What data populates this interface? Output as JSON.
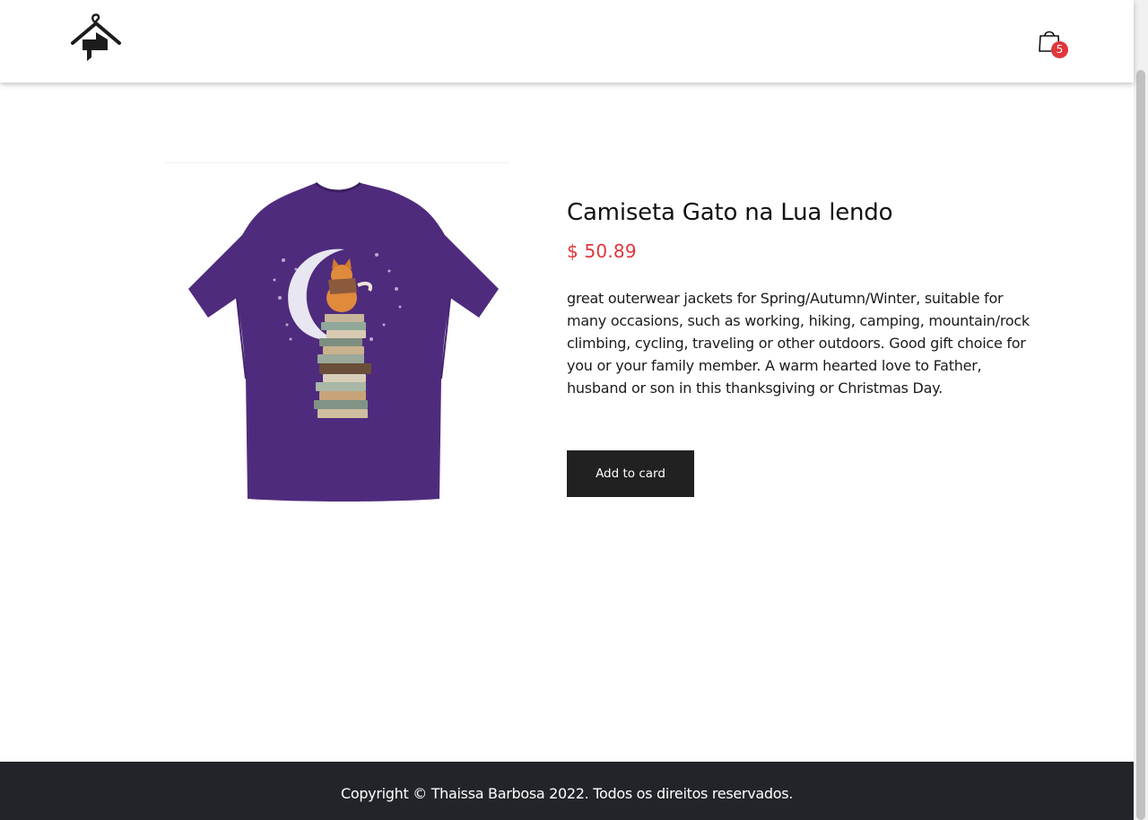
{
  "header": {
    "logo_icon": "hanger-house-logo-icon",
    "cart_icon": "shopping-bag-icon",
    "cart_count": "5",
    "cart_badge_color": "#e0353b"
  },
  "product": {
    "image_icon": "purple-tshirt-cat-moon-books-image",
    "title": "Camiseta Gato na Lua lendo",
    "price": "$ 50.89",
    "price_color": "#e0353b",
    "description": "great outerwear jackets for Spring/Autumn/Winter, suitable for many occasions, such as working, hiking, camping, mountain/rock climbing, cycling, traveling or other outdoors. Good gift choice for you or your family member. A warm hearted love to Father, husband or son in this thanksgiving or Christmas Day.",
    "add_button_label": "Add to card",
    "tshirt_color": "#4f2b7d"
  },
  "footer": {
    "copyright": "Copyright © Thaissa Barbosa 2022. Todos os direitos reservados.",
    "background": "#212529"
  }
}
